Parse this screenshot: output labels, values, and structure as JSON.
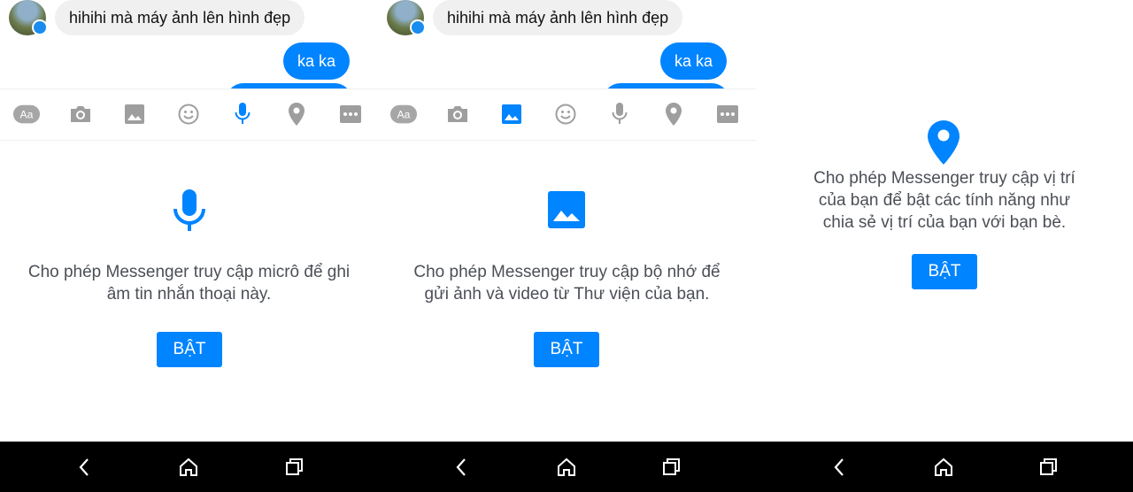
{
  "messages": {
    "incoming": "hihihi mà máy ảnh lên hình đẹp",
    "outgoing": "ka ka"
  },
  "toolbar": {
    "text_icon": "Aa",
    "icons": [
      "text-aa",
      "camera",
      "gallery",
      "emoji",
      "microphone",
      "location",
      "more"
    ]
  },
  "panels": [
    {
      "permission": "microphone",
      "text_line1": "Cho phép Messenger truy cập micrô để ghi",
      "text_line2": "âm tin nhắn thoại này.",
      "button": "BẬT"
    },
    {
      "permission": "storage",
      "text_line1": "Cho phép Messenger truy cập bộ nhớ để",
      "text_line2": "gửi ảnh và video từ Thư viện của bạn.",
      "button": "BẬT"
    },
    {
      "permission": "location",
      "text_line1": "Cho phép Messenger truy cập vị trí",
      "text_line2": "của bạn để bật các tính năng như",
      "text_line3": "chia sẻ vị trí của bạn với bạn bè.",
      "button": "BẬT"
    }
  ],
  "colors": {
    "accent": "#0084ff",
    "icon_gray": "#9e9e9e",
    "text": "#4b4f56",
    "navbar": "#000000"
  }
}
